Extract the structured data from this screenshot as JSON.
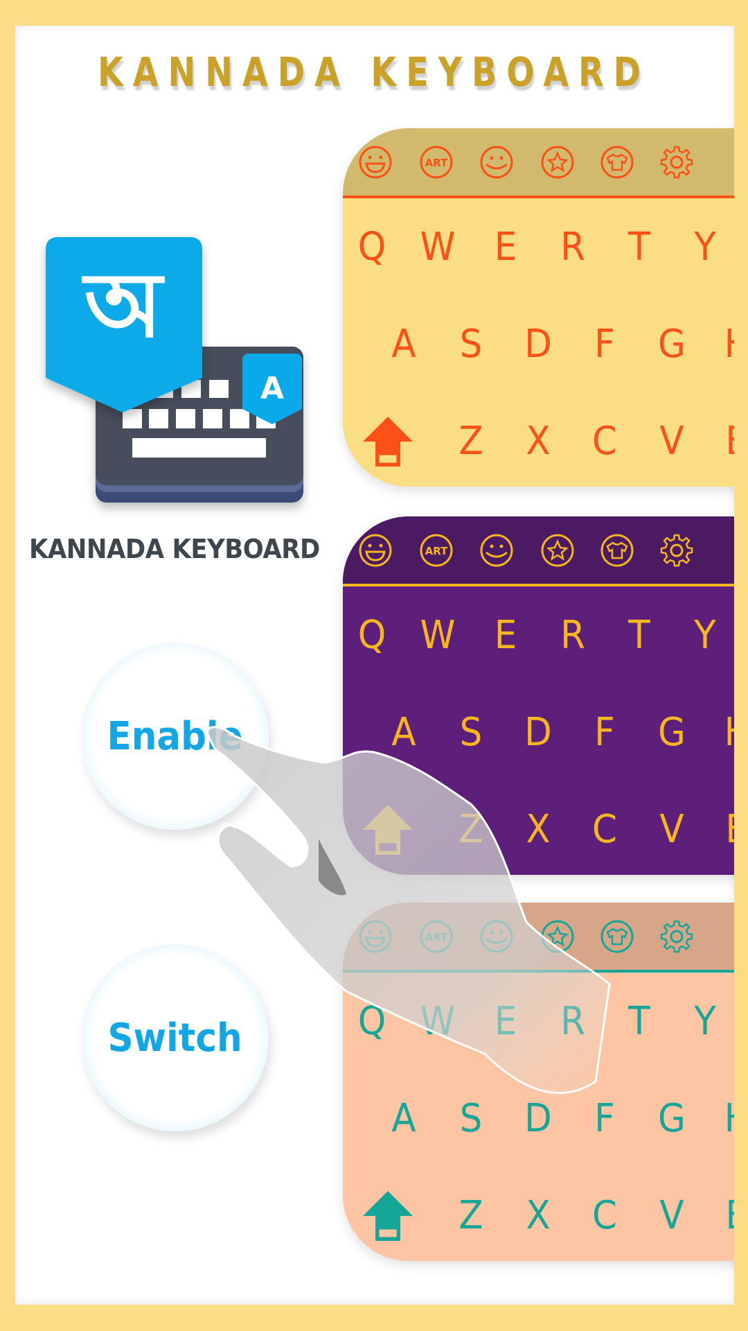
{
  "header": {
    "title": "KANNADA KEYBOARD"
  },
  "app": {
    "name": "KANNADA KEYBOARD",
    "logo_glyph": "অ",
    "logo_badge": "A"
  },
  "buttons": {
    "enable": "Enable",
    "switch": "Switch"
  },
  "toolbar_icons": [
    "emoji-laugh-icon",
    "art-icon",
    "smiley-icon",
    "star-icon",
    "theme-shirt-icon",
    "settings-gear-icon"
  ],
  "art_label": "ART",
  "keyboards": [
    {
      "theme": "yellow",
      "bar_color": "#D1B96E",
      "bg_color": "#FBDD84",
      "accent": "#FB5016"
    },
    {
      "theme": "purple",
      "bar_color": "#4B1A62",
      "bg_color": "#5E1F7B",
      "accent": "#F6B71E"
    },
    {
      "theme": "peach",
      "bar_color": "#D7A689",
      "bg_color": "#FDC5A3",
      "accent": "#14A697"
    }
  ],
  "rows": {
    "row1": [
      "Q",
      "W",
      "E",
      "R",
      "T",
      "Y"
    ],
    "row2": [
      "A",
      "S",
      "D",
      "F",
      "G",
      "H"
    ],
    "row3": [
      "Z",
      "X",
      "C",
      "V",
      "B"
    ]
  },
  "colors": {
    "frame": "#FADD85",
    "title": "#C9A227",
    "button_text": "#12A6E6",
    "logo_blue": "#0AAAEA",
    "logo_dark": "#474D5C"
  }
}
